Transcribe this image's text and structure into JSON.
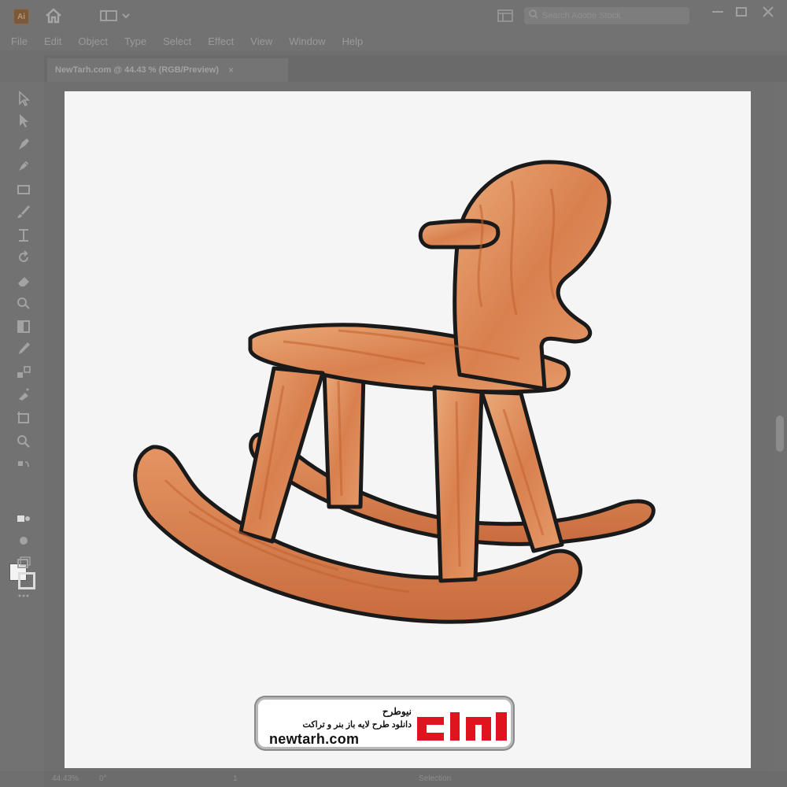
{
  "app": {
    "logo_text": "Ai",
    "search_placeholder": "Search Adobe Stock"
  },
  "menu": {
    "items": [
      "File",
      "Edit",
      "Object",
      "Type",
      "Select",
      "Effect",
      "View",
      "Window",
      "Help"
    ]
  },
  "document": {
    "tab_title": "NewTarh.com @ 44.43 % (RGB/Preview)",
    "close_glyph": "×"
  },
  "toolbar": {
    "tools": [
      "selection-icon",
      "direct-selection-icon",
      "pen-icon",
      "curvature-icon",
      "rectangle-icon",
      "paintbrush-icon",
      "shaper-icon",
      "rotate-icon",
      "eraser-icon",
      "shape-builder-icon",
      "gradient-icon",
      "eyedropper-icon",
      "blend-icon",
      "symbol-sprayer-icon",
      "artboard-icon",
      "zoom-icon"
    ]
  },
  "status": {
    "zoom": "44.43%",
    "rotation": "0°",
    "page": "1",
    "tool": "Selection"
  },
  "watermark": {
    "name": "نیوطرح",
    "tagline": "دانلود طرح لایه باز بنر و تراکت",
    "url": "newtarh.com",
    "mark_text": "نیوطرح",
    "mark_color": "#e0141e"
  },
  "colors": {
    "ui_gray": "#727272",
    "artboard": "#f5f5f5",
    "wood_light": "#e9a06e",
    "wood_dark": "#c4683a",
    "outline": "#1a1a1a"
  }
}
